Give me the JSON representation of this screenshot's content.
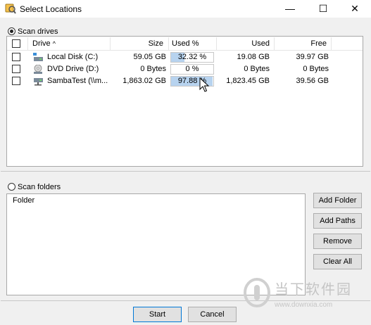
{
  "window": {
    "title": "Select Locations",
    "controls": {
      "minimize": "—",
      "maximize": "☐",
      "close": "✕"
    }
  },
  "drives": {
    "radio_label": "Scan drives",
    "selected": true,
    "columns": {
      "drive": "Drive",
      "sort_indicator": "^",
      "size": "Size",
      "used_pct": "Used %",
      "used": "Used",
      "free": "Free"
    },
    "rows": [
      {
        "name": "Local Disk (C:)",
        "icon": "hard-drive-icon",
        "size": "59.05 GB",
        "used_pct_text": "32.32 %",
        "used_fraction": 0.3232,
        "used": "19.08 GB",
        "free": "39.97 GB"
      },
      {
        "name": "DVD Drive (D:)",
        "icon": "dvd-drive-icon",
        "size": "0 Bytes",
        "used_pct_text": "0 %",
        "used_fraction": 0,
        "used": "0 Bytes",
        "free": "0 Bytes"
      },
      {
        "name": "SambaTest (\\\\m...",
        "icon": "network-drive-icon",
        "size": "1,863.02 GB",
        "used_pct_text": "97.88 %",
        "used_fraction": 0.9788,
        "used": "1,823.45 GB",
        "free": "39.56 GB"
      }
    ]
  },
  "folders": {
    "radio_label": "Scan folders",
    "selected": false,
    "column_header": "Folder",
    "buttons": {
      "add_folder": "Add Folder",
      "add_paths": "Add Paths",
      "remove": "Remove",
      "clear_all": "Clear All"
    }
  },
  "footer": {
    "start": "Start",
    "cancel": "Cancel"
  },
  "watermark": {
    "text": "当下软件园",
    "url": "www.downxia.com"
  },
  "colors": {
    "progress_fill": "#b7d3ef",
    "default_button_border": "#0078d7"
  }
}
